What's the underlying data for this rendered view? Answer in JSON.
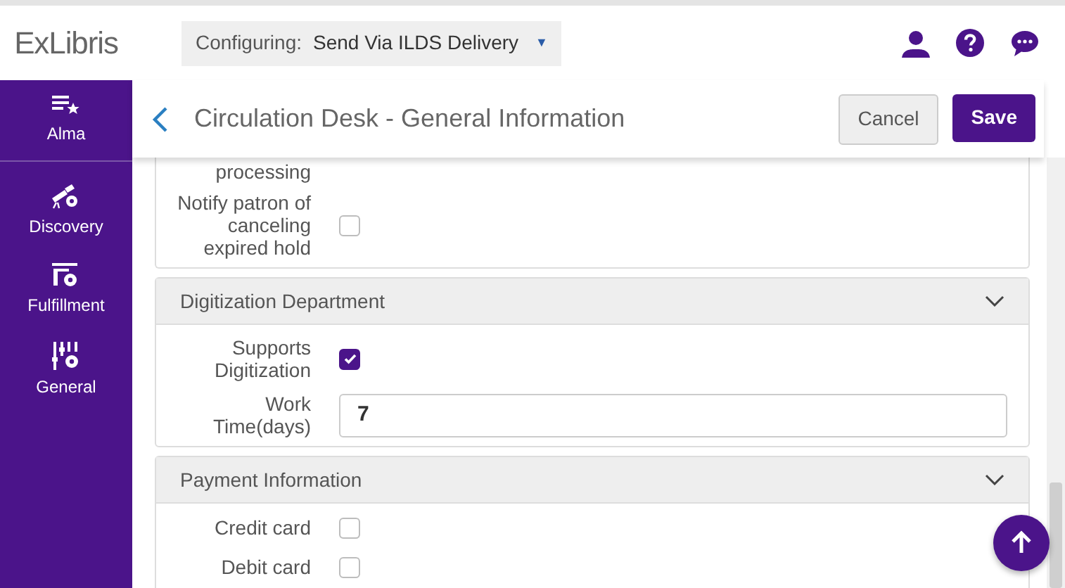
{
  "header": {
    "logo": "ExLibris",
    "configuring_label": "Configuring:",
    "configuring_value": "Send Via ILDS Delivery",
    "dropdown_caret": "▼"
  },
  "sidebar": {
    "items": [
      {
        "label": "Alma"
      },
      {
        "label": "Discovery"
      },
      {
        "label": "Fulfillment"
      },
      {
        "label": "General"
      }
    ]
  },
  "page": {
    "title": "Circulation Desk - General Information",
    "buttons": [
      {
        "label": "Cancel",
        "kind": "secondary"
      },
      {
        "label": "Save",
        "kind": "primary"
      }
    ]
  },
  "sections": [
    {
      "rows": [
        {
          "kind": "text",
          "label": "processing"
        },
        {
          "kind": "checkbox",
          "label": "Notify patron of canceling expired hold",
          "checked": false
        }
      ]
    },
    {
      "title": "Digitization Department",
      "expanded": true,
      "rows": [
        {
          "kind": "checkbox",
          "label": "Supports Digitization",
          "checked": true
        },
        {
          "kind": "input",
          "label": "Work Time(days)",
          "value": "7"
        }
      ]
    },
    {
      "title": "Payment Information",
      "expanded": true,
      "rows": [
        {
          "kind": "checkbox",
          "label": "Credit card",
          "checked": false
        },
        {
          "kind": "checkbox",
          "label": "Debit card",
          "checked": false
        }
      ]
    }
  ]
}
